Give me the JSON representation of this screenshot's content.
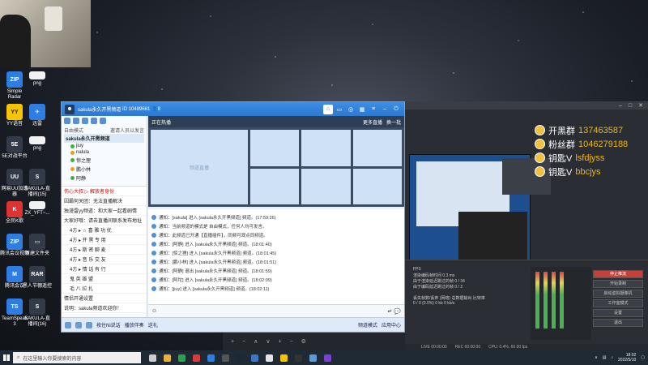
{
  "desktop": {
    "icons": [
      {
        "label": "Simple Radar",
        "glyph": "ZIP",
        "color": "blue"
      },
      {
        "label": "png",
        "glyph": "",
        "color": "white"
      },
      {
        "label": "YY语音",
        "glyph": "YY",
        "color": "yy"
      },
      {
        "label": "迅雷",
        "glyph": "✈",
        "color": "blue"
      },
      {
        "label": "5E对战平台",
        "glyph": "5E",
        "color": "dark"
      },
      {
        "label": "png",
        "glyph": "",
        "color": "white"
      },
      {
        "label": "网易UU加速器",
        "glyph": "UU",
        "color": "dark"
      },
      {
        "label": "SAKULA-直播间(15)",
        "glyph": "S",
        "color": "dark"
      },
      {
        "label": "全民K歌",
        "glyph": "K",
        "color": "red"
      },
      {
        "label": "ZX_YFT~...",
        "glyph": "",
        "color": "white"
      },
      {
        "label": "腾讯会议视频",
        "glyph": "ZIP",
        "color": "blue"
      },
      {
        "label": "新建文件夹",
        "glyph": "▭",
        "color": "dark"
      },
      {
        "label": "腾讯会议",
        "glyph": "M",
        "color": "blue"
      },
      {
        "label": "黑人节棚遥控",
        "glyph": "RAR",
        "color": "dark"
      },
      {
        "label": "TeamSpeak 3",
        "glyph": "TS",
        "color": "blue"
      },
      {
        "label": "SAKULA-直播间(16)",
        "glyph": "S",
        "color": "dark"
      }
    ]
  },
  "chat_window": {
    "title": "sakula永久开黑频道",
    "channel_id": "ID 10489661",
    "user_count": "8",
    "mode_label": "自由模式",
    "mode_action": "邀请人员以发言",
    "tree_root": "sakula永久开黑频道",
    "users": [
      "jiuy",
      "nalula",
      "惊之狸",
      "鹏小林",
      "阿静"
    ],
    "left_list": [
      {
        "text": "伤心大叔 ▷ 解放者身份",
        "style": "red"
      },
      {
        "text": "因霸何关团：无法直播解决",
        "style": ""
      },
      {
        "text": "独漫雷yy频道：和大家一起看剧情",
        "style": ""
      },
      {
        "text": "大家好哦：请去直播间联系发布地址",
        "style": ""
      },
      {
        "text": "4方 ▸ ☆ 喜 雅 功 优",
        "style": "sub"
      },
      {
        "text": "4方 ▸ 开 黑 专 用",
        "style": "sub"
      },
      {
        "text": "4方 ▸ 斯 密 聊 麦",
        "style": "sub"
      },
      {
        "text": "4方 ▸ 音 乐 交 友",
        "style": "sub"
      },
      {
        "text": "4方 ▸ 情 话 有 行",
        "style": "sub"
      },
      {
        "text": "鬼 英 雄 盟",
        "style": "sub"
      },
      {
        "text": "毛 八 拉 扎",
        "style": "sub"
      },
      {
        "text": "情侣开通设置",
        "style": ""
      },
      {
        "text": "说明：sakula频道欢迎你！",
        "style": ""
      }
    ],
    "hot_header": "正在热播",
    "hot_more": "更多直播",
    "hot_refresh": "换一批",
    "hot_placeholder": "频道直播",
    "messages": [
      "通知：[sakula] 进入 [sakula永久开黑频道] 频道。(17:59:26)",
      "通知：当前频道的模式是 自由模式，任何人均可发言。",
      "通知：此频道已开通【直播插件】，同频可观点同频道。",
      "通知：[阿静] 进入 [sakula永久开黑频道] 频道。(18:01:40)",
      "通知：[惊之狸] 进入 [sakula永久开黑频道] 频道。(18:01:45)",
      "通知：[鹏小林] 进入 [sakula永久开黑频道] 频道。(18:01:51)",
      "通知：[阿静] 退出 [sakula永久开黑频道] 频道。(18:01:59)",
      "通知：[阿坨] 进入 [sakula永久开黑频道] 频道。(18:02:09)",
      "通知：[jiuy] 进入 [sakula永久开黑频道] 频道。(18:02:11)"
    ],
    "bottom": {
      "record": "按住Ni说话",
      "play_music": "播放伴奏",
      "gift": "送礼",
      "mode": "频道模式",
      "center": "应用中心"
    }
  },
  "overlay": {
    "rows": [
      {
        "label": "开黑群",
        "value": "137463587"
      },
      {
        "label": "粉丝群",
        "value": "1046279188"
      },
      {
        "label": "钥匙V",
        "value": "lsfdjyss"
      },
      {
        "label": "钥匙V",
        "value": "bbcjys"
      }
    ]
  },
  "obs": {
    "stats": [
      "FPS",
      "渲染编码帧时间 0.3 ms",
      "由于渲染延迟跳过的帧 0 / 34",
      "由于编码延迟跳过的帧 0 / 2",
      "",
      "丢失帧数/丢弃 (网络)    总数据输出    比特率",
      "0 / 0 (0.0%)    0 kb    0 kb/s"
    ],
    "controls": [
      "停止推流",
      "开始录制",
      "启动虚拟摄像机",
      "工作室模式",
      "设置",
      "退出"
    ],
    "mixer_title": "音频混音器",
    "status": [
      "LIVE 00:00:00",
      "REC 00:00:00",
      "CPU: 0.4%, 60.00 fps"
    ]
  },
  "taskbar": {
    "search_placeholder": "在这里输入你要搜索的内容",
    "time": "18:02",
    "date": "2022/5/10"
  }
}
